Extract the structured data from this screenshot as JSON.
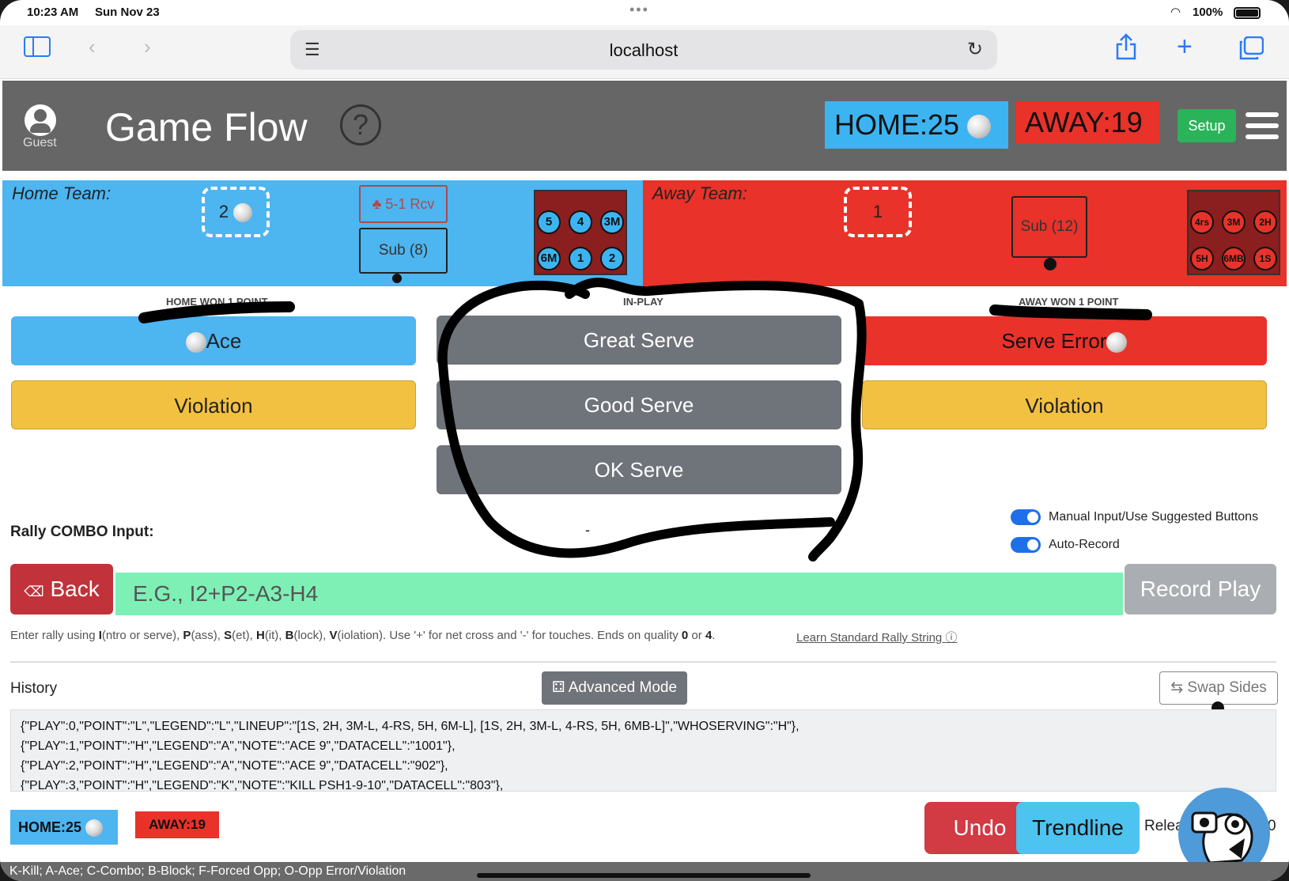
{
  "status_bar": {
    "time": "10:23 AM",
    "date": "Sun Nov 23",
    "battery": "100%"
  },
  "browser": {
    "url": "localhost"
  },
  "header": {
    "user_label": "Guest",
    "title": "Game Flow",
    "help": "?",
    "home_score": "HOME:25",
    "away_score": "AWAY:19",
    "setup_label": "Setup"
  },
  "home_team": {
    "label": "Home Team:",
    "rotation": "2",
    "formation_label": "5-1 Rcv",
    "sub_label": "Sub (8)",
    "positions": [
      "5",
      "4",
      "3M",
      "6M",
      "1",
      "2"
    ]
  },
  "away_team": {
    "label": "Away Team:",
    "rotation": "1",
    "sub_label": "Sub (12)",
    "positions": [
      "4rs",
      "3M",
      "2H",
      "5H",
      "6MB",
      "1S"
    ]
  },
  "sections": {
    "home_won": "HOME WON 1 POINT",
    "in_play": "IN-PLAY",
    "away_won": "AWAY WON 1 POINT"
  },
  "buttons": {
    "ace": "Ace",
    "home_violation": "Violation",
    "great_serve": "Great Serve",
    "good_serve": "Good Serve",
    "ok_serve": "OK Serve",
    "serve_error": "Serve Error",
    "away_violation": "Violation",
    "dash": "-"
  },
  "rally": {
    "label": "Rally COMBO Input:",
    "manual_toggle": "Manual Input/Use Suggested Buttons",
    "auto_toggle": "Auto-Record",
    "back_label": "Back",
    "placeholder": "E.G., I2+P2-A3-H4",
    "record_label": "Record Play",
    "help_text_parts": [
      "Enter rally using ",
      "I",
      "(ntro or serve), ",
      "P",
      "(ass), ",
      "S",
      "(et), ",
      "H",
      "(it), ",
      "B",
      "(lock), ",
      "V",
      "(iolation). Use '+' for net cross and '-' for touches. Ends on quality ",
      "0",
      " or ",
      "4",
      "."
    ],
    "learn_link": "Learn Standard Rally String"
  },
  "history": {
    "label": "History",
    "advanced_label": "Advanced Mode",
    "swap_label": "Swap Sides",
    "lines": [
      "{\"PLAY\":0,\"POINT\":\"L\",\"LEGEND\":\"L\",\"LINEUP\":\"[1S, 2H, 3M-L, 4-RS, 5H, 6M-L], [1S, 2H, 3M-L, 4-RS, 5H, 6MB-L]\",\"WHOSERVING\":\"H\"},",
      "{\"PLAY\":1,\"POINT\":\"H\",\"LEGEND\":\"A\",\"NOTE\":\"ACE 9\",\"DATACELL\":\"1001\"},",
      "{\"PLAY\":2,\"POINT\":\"H\",\"LEGEND\":\"A\",\"NOTE\":\"ACE 9\",\"DATACELL\":\"902\"},",
      "{\"PLAY\":3,\"POINT\":\"H\",\"LEGEND\":\"K\",\"NOTE\":\"KILL PSH1-9-10\",\"DATACELL\":\"803\"},"
    ]
  },
  "footer": {
    "home_score": "HOME:25",
    "away_score": "AWAY:19",
    "undo_label": "Undo",
    "trendline_label": "Trendline",
    "release_text": "Relea",
    "release_end": "0",
    "legend": "K-Kill; A-Ace; C-Combo; B-Block; F-Forced Opp; O-Opp Error/Violation"
  },
  "colors": {
    "home": "#4db5f0",
    "away": "#e8322a",
    "neutral": "#6f737a",
    "violation": "#f2c141",
    "rally_input": "#7ef0b6"
  }
}
